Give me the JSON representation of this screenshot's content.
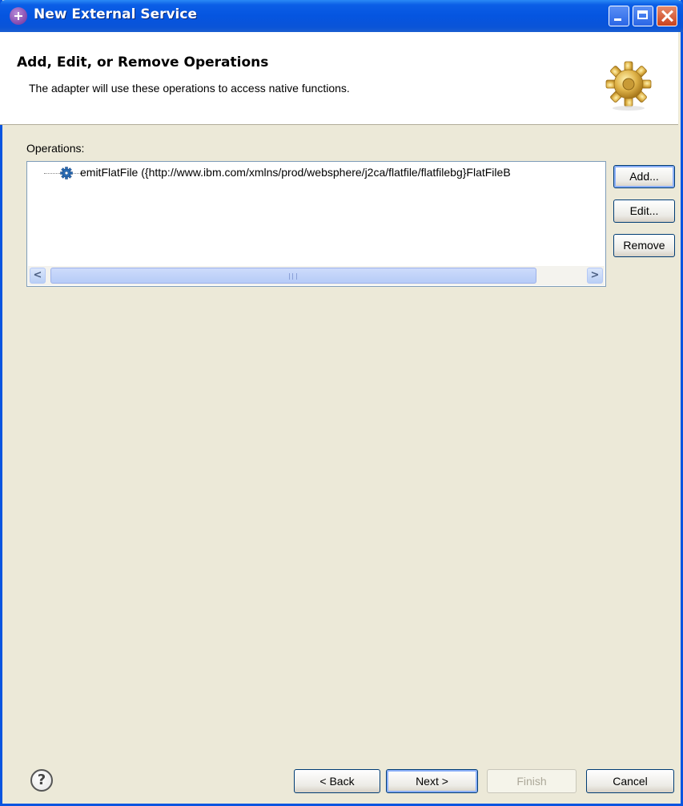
{
  "window": {
    "title": "New External Service",
    "controls": {
      "minimize": "minimize-icon",
      "maximize": "maximize-icon",
      "close": "close-icon"
    }
  },
  "banner": {
    "title": "Add, Edit, or Remove Operations",
    "description": "The adapter will use these operations to access native functions.",
    "icon": "gear-icon"
  },
  "operations": {
    "label": "Operations:",
    "items": [
      {
        "icon": "operation-gear-icon",
        "text": "emitFlatFile ({http://www.ibm.com/xmlns/prod/websphere/j2ca/flatfile/flatfilebg}FlatFileB"
      }
    ],
    "scrollbar": {
      "left": "<",
      "right": ">",
      "grip": "III"
    }
  },
  "side_buttons": {
    "add": "Add...",
    "edit": "Edit...",
    "remove": "Remove"
  },
  "footer": {
    "help": "?",
    "back": "< Back",
    "next": "Next >",
    "finish": "Finish",
    "cancel": "Cancel"
  },
  "colors": {
    "titlebar": "#0555e0",
    "dialog_bg": "#ece9d8",
    "list_border": "#7f9db9"
  }
}
